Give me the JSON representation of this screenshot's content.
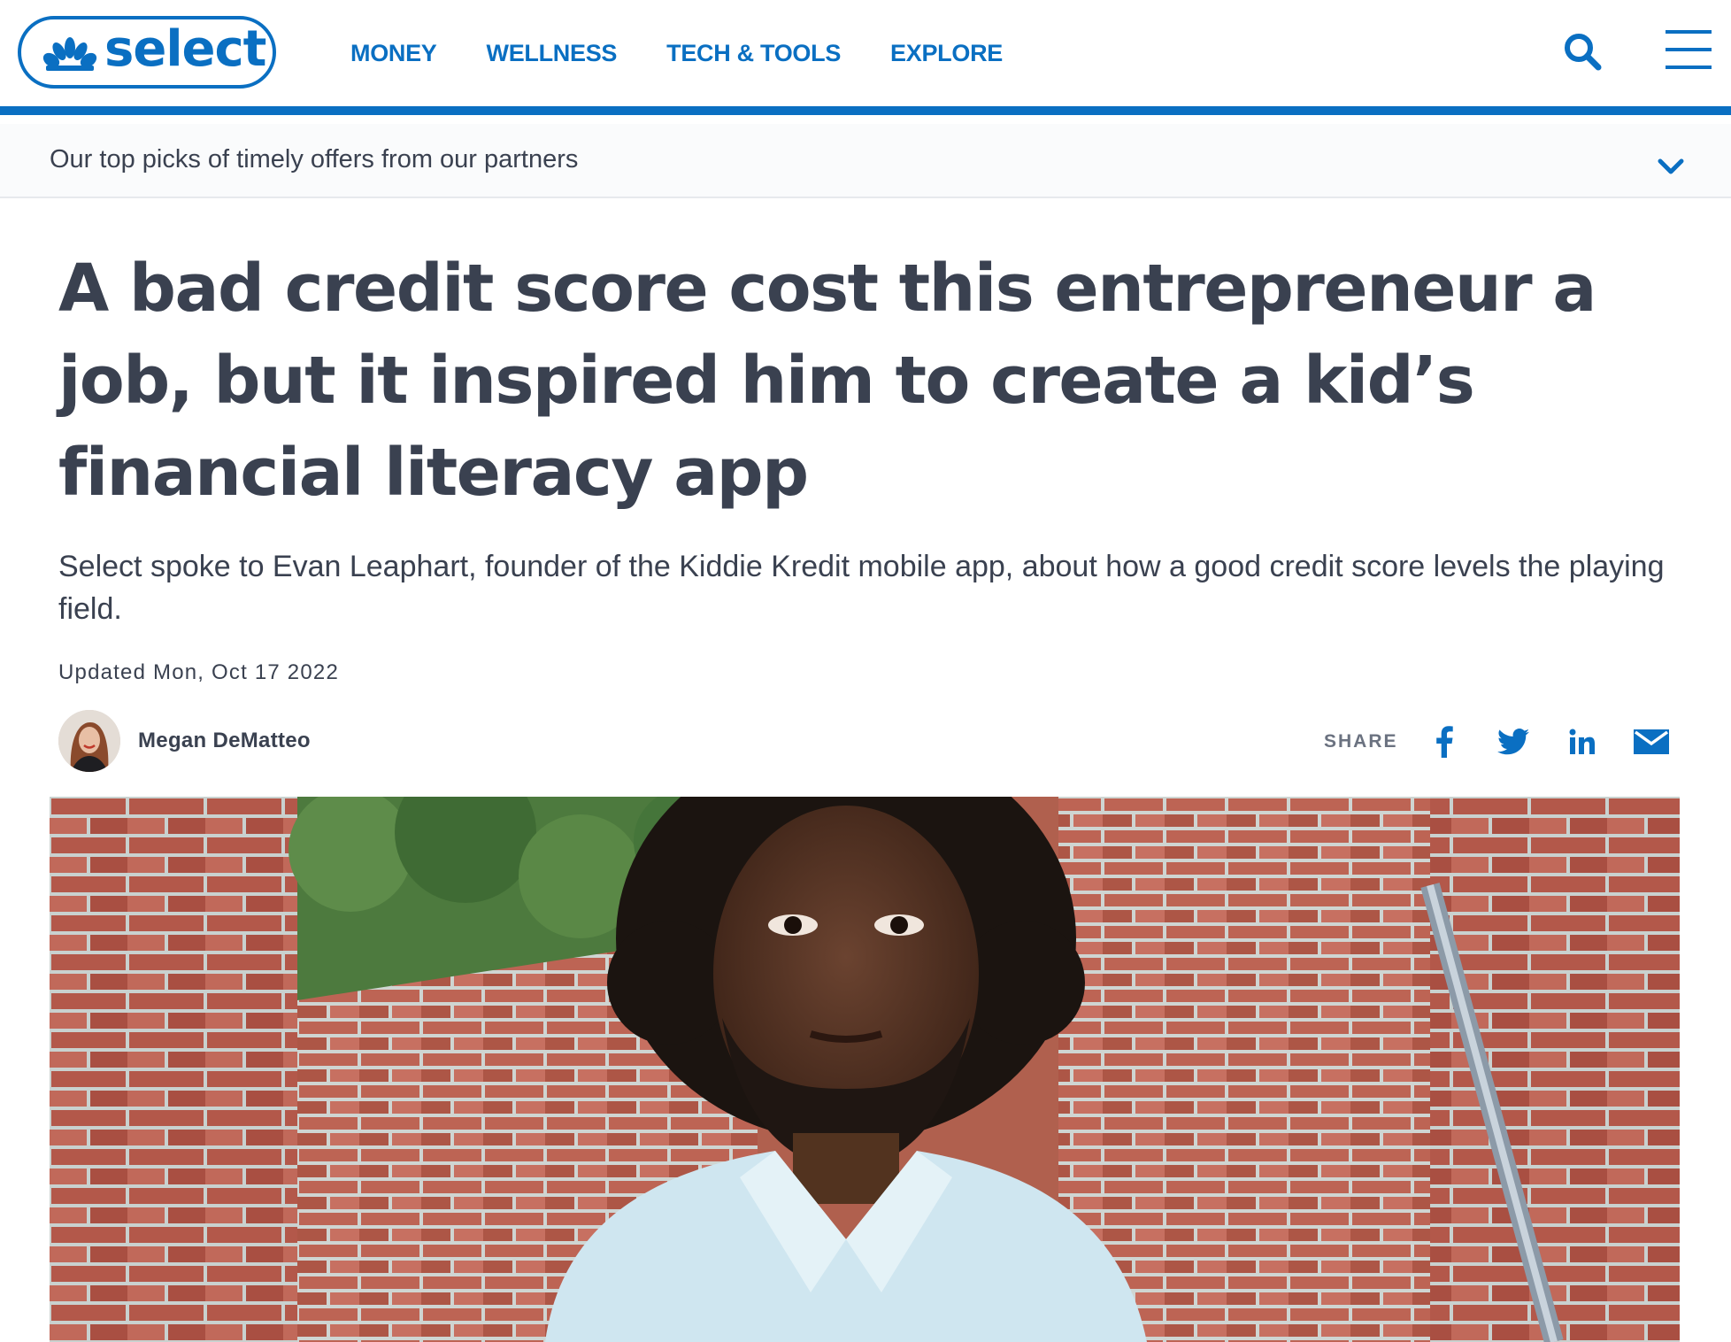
{
  "header": {
    "logo_text": "select",
    "nav": [
      {
        "label": "MONEY"
      },
      {
        "label": "WELLNESS"
      },
      {
        "label": "TECH & TOOLS"
      },
      {
        "label": "EXPLORE"
      }
    ],
    "icons": {
      "search": "search-icon",
      "menu": "hamburger-menu-icon"
    }
  },
  "offers_bar": {
    "text": "Our top picks of timely offers from our partners",
    "icon": "chevron-down-icon"
  },
  "article": {
    "headline": "A bad credit score cost this entrepreneur a job, but it inspired him to create a kid’s financial literacy app",
    "dek": "Select spoke to Evan Leaphart, founder of the Kiddie Kredit mobile app, about how a good credit score levels the playing field.",
    "updated": "Updated Mon, Oct 17 2022",
    "author": {
      "name": "Megan DeMatteo"
    },
    "share": {
      "label": "SHARE",
      "icons": [
        "facebook-icon",
        "twitter-icon",
        "linkedin-icon",
        "email-icon"
      ]
    }
  },
  "colors": {
    "brand_blue": "#0a6fc2",
    "text_dark": "#3a4150",
    "text_muted": "#6b7280"
  }
}
